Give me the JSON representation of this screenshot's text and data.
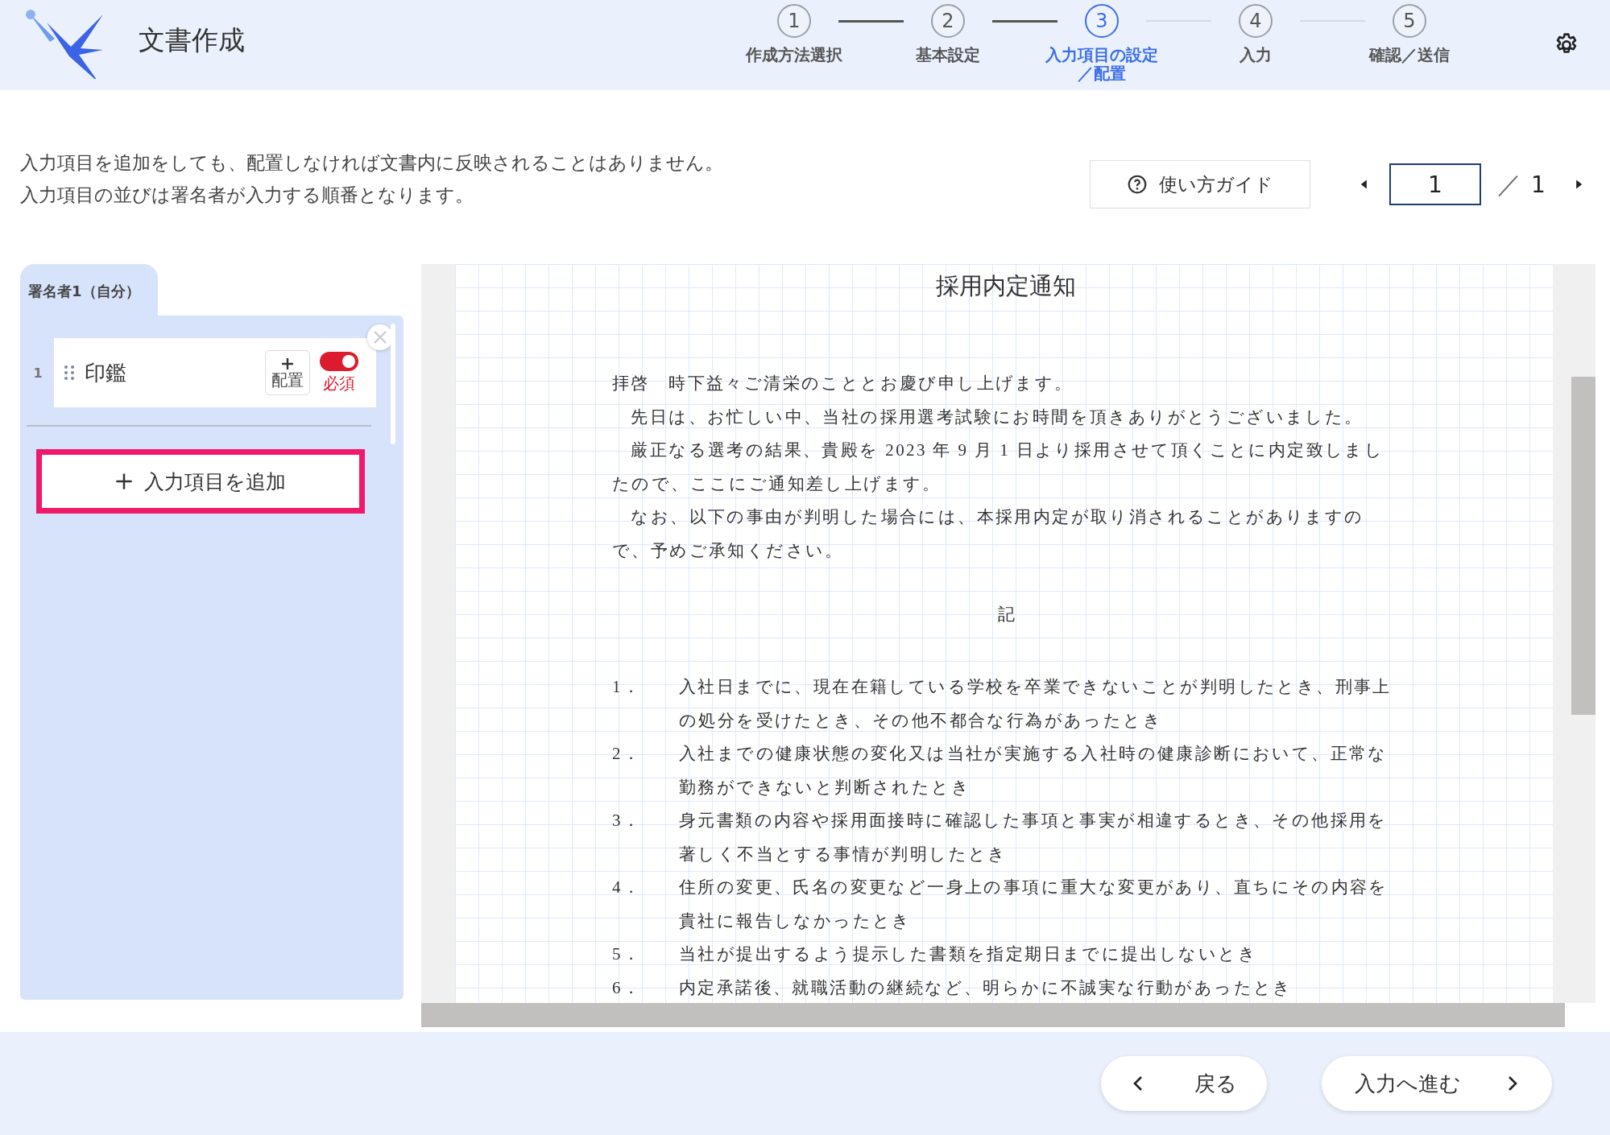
{
  "app": {
    "title": "文書作成"
  },
  "steps": [
    {
      "number": "1",
      "label": "作成方法選択",
      "selected": false
    },
    {
      "number": "2",
      "label": "基本設定",
      "selected": false
    },
    {
      "number": "3",
      "label": "入力項目の設定／配置",
      "selected": true
    },
    {
      "number": "4",
      "label": "入力",
      "selected": false
    },
    {
      "number": "5",
      "label": "確認／送信",
      "selected": false
    }
  ],
  "instructions": [
    "入力項目を追加をしても、配置しなければ文書内に反映されることはありません。",
    "入力項目の並びは署名者が入力する順番となります。"
  ],
  "guide_button": "使い方ガイド",
  "pagination": {
    "page": "1",
    "separator": "／",
    "total": "1"
  },
  "signer_tabs": [
    {
      "label": "署名者1（自分）",
      "selected": true
    }
  ],
  "fields": [
    {
      "number": "1",
      "name": "印鑑",
      "place_button": "配置",
      "required": true,
      "required_label": "必須"
    }
  ],
  "add_button": {
    "label": "入力項目を追加",
    "highlighted": true
  },
  "document": {
    "title": "採用内定通知",
    "paragraphs": [
      "拝啓　時下益々ご清栄のこととお慶び申し上げます。",
      "　先日は、お忙しい中、当社の採用選考試験にお時間を頂きありがとうございました。",
      "　厳正なる選考の結果、貴殿を 2023 年 9 月 1 日より採用させて頂くことに内定致しましたので、ここにご通知差し上げます。",
      "　なお、以下の事由が判明した場合には、本採用内定が取り消されることがありますので、予めご承知ください。"
    ],
    "heading": "記",
    "items": [
      {
        "number": "1．",
        "text": "入社日までに、現在在籍している学校を卒業できないことが判明したとき、刑事上の処分を受けたとき、その他不都合な行為があったとき"
      },
      {
        "number": "2．",
        "text": "入社までの健康状態の変化又は当社が実施する入社時の健康診断において、正常な勤務ができないと判断されたとき"
      },
      {
        "number": "3．",
        "text": "身元書類の内容や採用面接時に確認した事項と事実が相違するとき、その他採用を著しく不当とする事情が判明したとき"
      },
      {
        "number": "4．",
        "text": "住所の変更、氏名の変更など一身上の事項に重大な変更があり、直ちにその内容を貴社に報告しなかったとき"
      },
      {
        "number": "5．",
        "text": "当社が提出するよう提示した書類を指定期日までに提出しないとき"
      },
      {
        "number": "6．",
        "text": "内定承諾後、就職活動の継続など、明らかに不誠実な行動があったとき"
      }
    ]
  },
  "footer": {
    "back_button": "戻る",
    "next_button": "入力へ進む"
  }
}
